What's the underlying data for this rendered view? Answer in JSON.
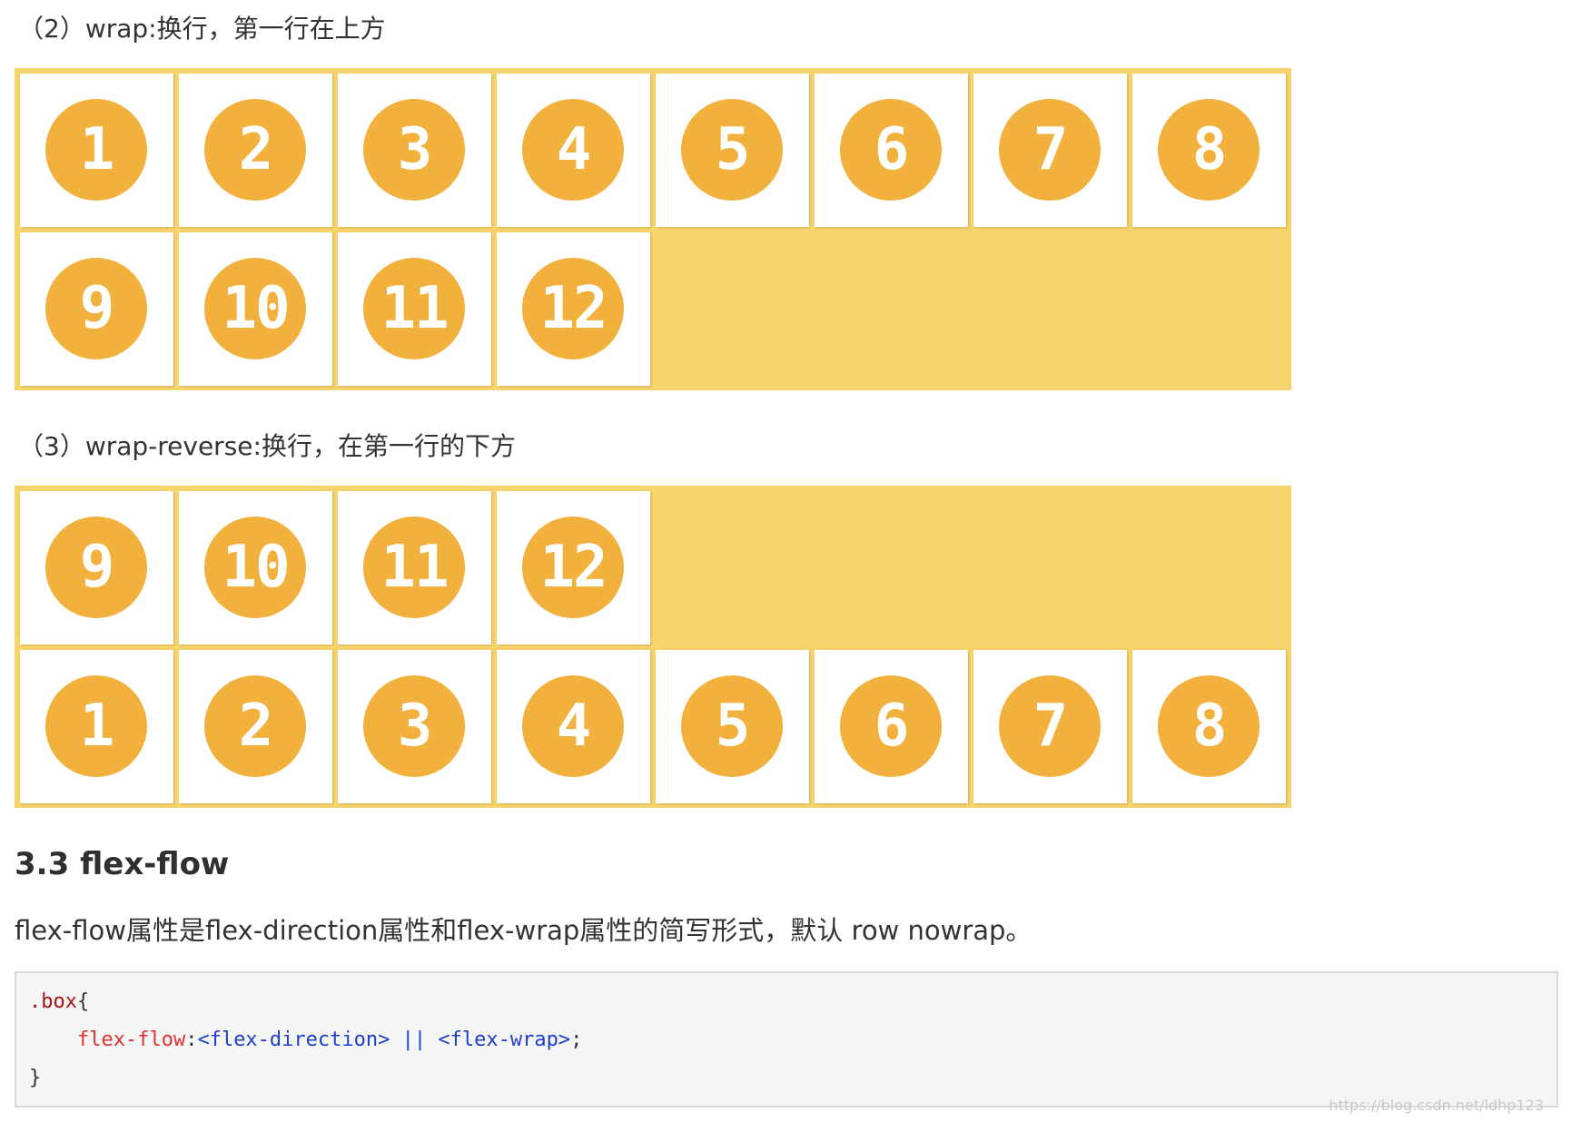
{
  "section_wrap": {
    "caption": "（2）wrap:换行，第一行在上方",
    "rows": [
      [
        "1",
        "2",
        "3",
        "4",
        "5",
        "6",
        "7",
        "8"
      ],
      [
        "9",
        "10",
        "11",
        "12"
      ]
    ]
  },
  "section_wrap_reverse": {
    "caption": "（3）wrap-reverse:换行，在第一行的下方",
    "rows": [
      [
        "9",
        "10",
        "11",
        "12"
      ],
      [
        "1",
        "2",
        "3",
        "4",
        "5",
        "6",
        "7",
        "8"
      ]
    ]
  },
  "heading": "3.3 flex-flow",
  "paragraph": "flex-flow属性是flex-direction属性和flex-wrap属性的简写形式，默认 row nowrap。",
  "code": {
    "selector": ".box",
    "open_brace": "{",
    "indent": "    ",
    "property": "flex-flow",
    "colon": ":",
    "value_1": "<flex-direction>",
    "separator": " || ",
    "value_2": "<flex-wrap>",
    "semicolon": ";",
    "close_brace": "}"
  },
  "watermark": "https://blog.csdn.net/ldhp123",
  "colors": {
    "container_bg": "#f7d36b",
    "tile_bg": "#ffffff",
    "circle_bg": "#f2b03c",
    "circle_text": "#ffffff"
  }
}
